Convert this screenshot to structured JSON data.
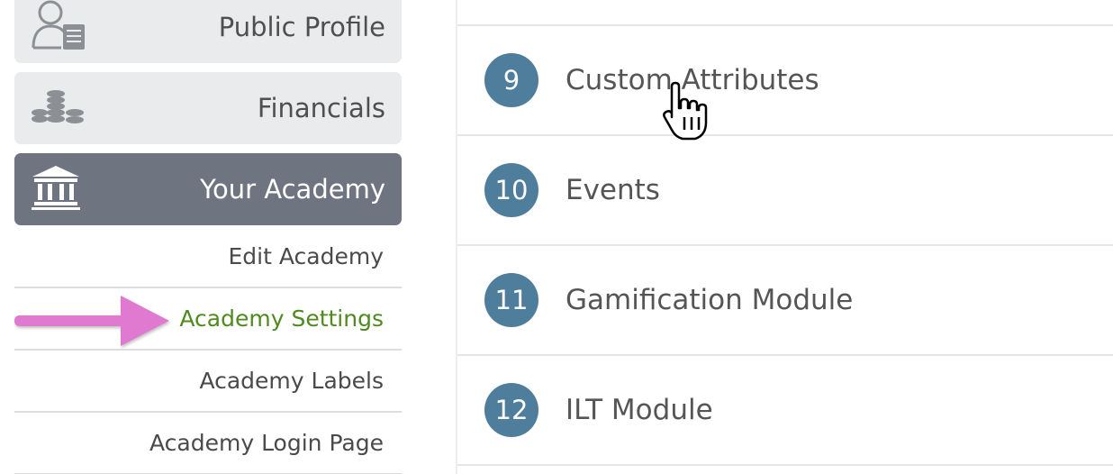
{
  "sidebar": {
    "nav_items": [
      {
        "label": "Public Profile",
        "icon": "user-profile-icon"
      },
      {
        "label": "Financials",
        "icon": "coins-stack-icon"
      },
      {
        "label": "Your Academy",
        "icon": "academy-building-icon"
      }
    ],
    "sub_items": [
      {
        "label": "Edit Academy"
      },
      {
        "label": "Academy Settings"
      },
      {
        "label": "Academy Labels"
      },
      {
        "label": "Academy Login Page"
      }
    ]
  },
  "main": {
    "items": [
      {
        "number": "9",
        "title": "Custom Attributes"
      },
      {
        "number": "10",
        "title": "Events"
      },
      {
        "number": "11",
        "title": "Gamification Module"
      },
      {
        "number": "12",
        "title": "ILT Module"
      }
    ]
  },
  "colors": {
    "nav_inactive_bg": "#eaebed",
    "nav_active_bg": "#6e7480",
    "sub_active_text": "#4f8a1f",
    "badge_bg": "#4e7e9c",
    "annotation_arrow": "#e07ad0"
  },
  "annotation": {
    "icon": "pointing-arrow-icon"
  },
  "cursor": {
    "icon": "hand-pointer-cursor-icon"
  }
}
